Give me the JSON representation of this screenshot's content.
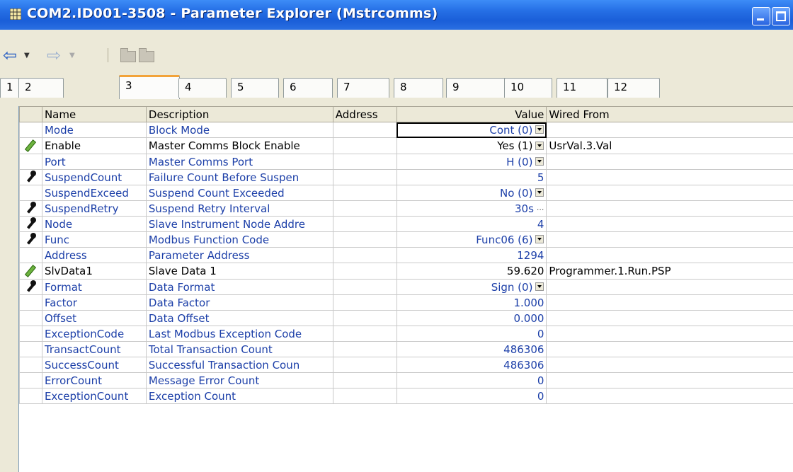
{
  "window": {
    "title": "COM2.ID001-3508 - Parameter Explorer (Mstrcomms)"
  },
  "toolbar": {
    "back_icon": "back-arrow-icon",
    "forward_icon": "forward-arrow-icon",
    "folder_icons": [
      "folder-icon",
      "folder-icon"
    ]
  },
  "tabs": [
    "1",
    "2",
    "3",
    "4",
    "5",
    "6",
    "7",
    "8",
    "9",
    "10",
    "11",
    "12"
  ],
  "active_tab": "3",
  "grid": {
    "columns": [
      "Name",
      "Description",
      "Address",
      "Value",
      "Wired From"
    ],
    "rows": [
      {
        "icon": "",
        "name": "Mode",
        "desc": "Block Mode",
        "address": "",
        "value": "Cont (0)",
        "control": "dropdown",
        "wired": "",
        "blue": true,
        "selected": true
      },
      {
        "icon": "pencil",
        "name": "Enable",
        "desc": "Master Comms Block Enable",
        "address": "",
        "value": "Yes (1)",
        "control": "dropdown",
        "wired": "UsrVal.3.Val",
        "blue": false
      },
      {
        "icon": "",
        "name": "Port",
        "desc": "Master Comms Port",
        "address": "",
        "value": "H (0)",
        "control": "dropdown",
        "wired": "",
        "blue": true
      },
      {
        "icon": "wrench",
        "name": "SuspendCount",
        "desc": "Failure Count Before Suspen",
        "address": "",
        "value": "5",
        "control": "",
        "wired": "",
        "blue": true
      },
      {
        "icon": "",
        "name": "SuspendExceed",
        "desc": "Suspend Count Exceeded",
        "address": "",
        "value": "No (0)",
        "control": "dropdown",
        "wired": "",
        "blue": true
      },
      {
        "icon": "wrench",
        "name": "SuspendRetry",
        "desc": "Suspend Retry Interval",
        "address": "",
        "value": "30s",
        "control": "ellipsis",
        "wired": "",
        "blue": true
      },
      {
        "icon": "wrench",
        "name": "Node",
        "desc": "Slave Instrument Node Addre",
        "address": "",
        "value": "4",
        "control": "",
        "wired": "",
        "blue": true
      },
      {
        "icon": "wrench",
        "name": "Func",
        "desc": "Modbus Function Code",
        "address": "",
        "value": "Func06 (6)",
        "control": "dropdown",
        "wired": "",
        "blue": true
      },
      {
        "icon": "",
        "name": "Address",
        "desc": "Parameter Address",
        "address": "",
        "value": "1294",
        "control": "",
        "wired": "",
        "blue": true
      },
      {
        "icon": "pencil",
        "name": "SlvData1",
        "desc": "Slave Data 1",
        "address": "",
        "value": "59.620",
        "control": "",
        "wired": "Programmer.1.Run.PSP",
        "blue": false
      },
      {
        "icon": "wrench",
        "name": "Format",
        "desc": "Data Format",
        "address": "",
        "value": "Sign (0)",
        "control": "dropdown",
        "wired": "",
        "blue": true
      },
      {
        "icon": "",
        "name": "Factor",
        "desc": "Data Factor",
        "address": "",
        "value": "1.000",
        "control": "",
        "wired": "",
        "blue": true
      },
      {
        "icon": "",
        "name": "Offset",
        "desc": "Data Offset",
        "address": "",
        "value": "0.000",
        "control": "",
        "wired": "",
        "blue": true
      },
      {
        "icon": "",
        "name": "ExceptionCode",
        "desc": "Last Modbus Exception Code",
        "address": "",
        "value": "0",
        "control": "",
        "wired": "",
        "blue": true
      },
      {
        "icon": "",
        "name": "TransactCount",
        "desc": "Total Transaction Count",
        "address": "",
        "value": "486306",
        "control": "",
        "wired": "",
        "blue": true
      },
      {
        "icon": "",
        "name": "SuccessCount",
        "desc": "Successful Transaction Coun",
        "address": "",
        "value": "486306",
        "control": "",
        "wired": "",
        "blue": true
      },
      {
        "icon": "",
        "name": "ErrorCount",
        "desc": "Message Error Count",
        "address": "",
        "value": "0",
        "control": "",
        "wired": "",
        "blue": true
      },
      {
        "icon": "",
        "name": "ExceptionCount",
        "desc": "Exception Count",
        "address": "",
        "value": "0",
        "control": "",
        "wired": "",
        "blue": true
      }
    ]
  }
}
